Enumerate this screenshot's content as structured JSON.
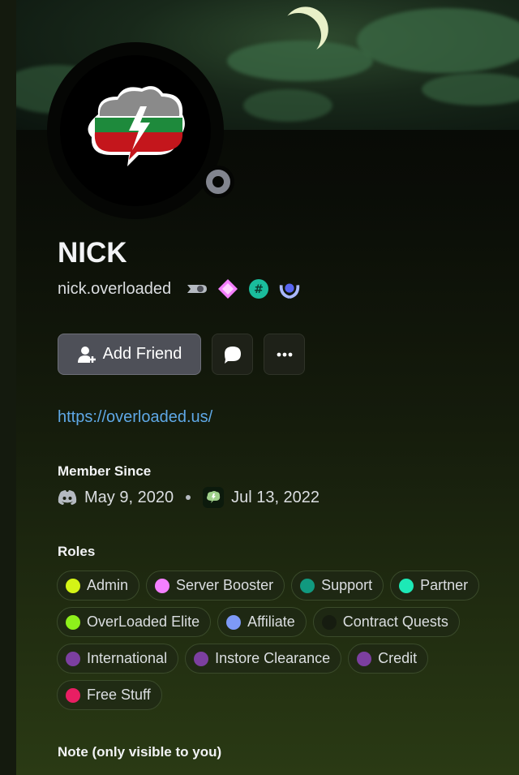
{
  "profile": {
    "display_name": "NICK",
    "username": "nick.overloaded",
    "badges": [
      "hypesquad-badge-icon",
      "nitro-gem-badge-icon",
      "hashtag-badge-icon",
      "laurel-badge-icon"
    ],
    "status": "offline"
  },
  "actions": {
    "add_friend_label": "Add Friend",
    "message_icon": "chat-bubble-icon",
    "more_icon": "ellipsis-icon"
  },
  "link": "https://overloaded.us/",
  "member_since": {
    "title": "Member Since",
    "discord_date": "May 9, 2020",
    "server_date": "Jul 13, 2022"
  },
  "roles": {
    "title": "Roles",
    "rows": [
      [
        {
          "name": "Admin",
          "color": "#d4f416"
        },
        {
          "name": "Server Booster",
          "color": "#f47fff"
        },
        {
          "name": "Support",
          "color": "#11997f"
        },
        {
          "name": "Partner",
          "color": "#1de9b6"
        }
      ],
      [
        {
          "name": "OverLoaded Elite",
          "color": "#8ef01b"
        },
        {
          "name": "Affiliate",
          "color": "#7e9af7"
        },
        {
          "name": "Contract Quests",
          "color": "#161c10"
        }
      ],
      [
        {
          "name": "International",
          "color": "#7c3fa0"
        },
        {
          "name": "Instore Clearance",
          "color": "#7c3fa0"
        },
        {
          "name": "Credit",
          "color": "#7c3fa0"
        }
      ],
      [
        {
          "name": "Free Stuff",
          "color": "#e91e63"
        }
      ]
    ]
  },
  "note": {
    "title": "Note (only visible to you)"
  }
}
